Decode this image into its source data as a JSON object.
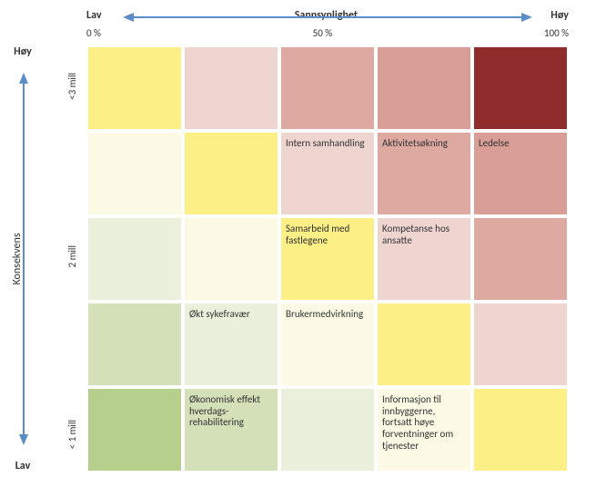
{
  "axis_top": {
    "title": "Sannsynlighet",
    "low": "Lav",
    "high": "Høy",
    "tick_low": "0 %",
    "tick_mid": "50 %",
    "tick_high": "100 %"
  },
  "axis_left": {
    "title": "Konsekvens",
    "low": "Lav",
    "high": "Høy",
    "tick_high": "<3 mill",
    "tick_mid": "2 mill",
    "tick_low": "< 1 mill"
  },
  "chart_data": {
    "type": "heatmap",
    "x_categories": [
      "0 %",
      "",
      "50 %",
      "",
      "100 %"
    ],
    "y_categories": [
      "<3 mill",
      "",
      "2 mill",
      "",
      "< 1 mill"
    ],
    "xlabel": "Sannsynlighet",
    "ylabel": "Konsekvens",
    "cells": [
      [
        {
          "color": "#fbef86",
          "text": ""
        },
        {
          "color": "#efd5d0",
          "text": ""
        },
        {
          "color": "#dda9a1",
          "text": ""
        },
        {
          "color": "#d99e95",
          "text": ""
        },
        {
          "color": "#8f2c2c",
          "text": ""
        }
      ],
      [
        {
          "color": "#fcfae4",
          "text": ""
        },
        {
          "color": "#fbef86",
          "text": ""
        },
        {
          "color": "#efd5d0",
          "text": "Intern samhandling"
        },
        {
          "color": "#dda9a1",
          "text": "Aktivitetsøkning"
        },
        {
          "color": "#d99e95",
          "text": "Ledelse"
        }
      ],
      [
        {
          "color": "#eaf0db",
          "text": ""
        },
        {
          "color": "#fcfae4",
          "text": ""
        },
        {
          "color": "#fbef86",
          "text": "Samarbeid med fastlegene"
        },
        {
          "color": "#efd5d0",
          "text": "Kompetanse hos ansatte"
        },
        {
          "color": "#dda9a1",
          "text": ""
        }
      ],
      [
        {
          "color": "#d3e0b8",
          "text": ""
        },
        {
          "color": "#eaf0db",
          "text": "Økt sykefravær"
        },
        {
          "color": "#fcfae4",
          "text": "Brukermedvirkning"
        },
        {
          "color": "#fbef86",
          "text": ""
        },
        {
          "color": "#efd5d0",
          "text": ""
        }
      ],
      [
        {
          "color": "#b7cf8d",
          "text": ""
        },
        {
          "color": "#d3e0b8",
          "text": "Økonomisk effekt hverdags-rehabilitering"
        },
        {
          "color": "#eaf0db",
          "text": ""
        },
        {
          "color": "#fcfae4",
          "text": "Informasjon til innbyggerne, fortsatt høye forventninger om tjenester"
        },
        {
          "color": "#fbef86",
          "text": ""
        }
      ]
    ]
  }
}
